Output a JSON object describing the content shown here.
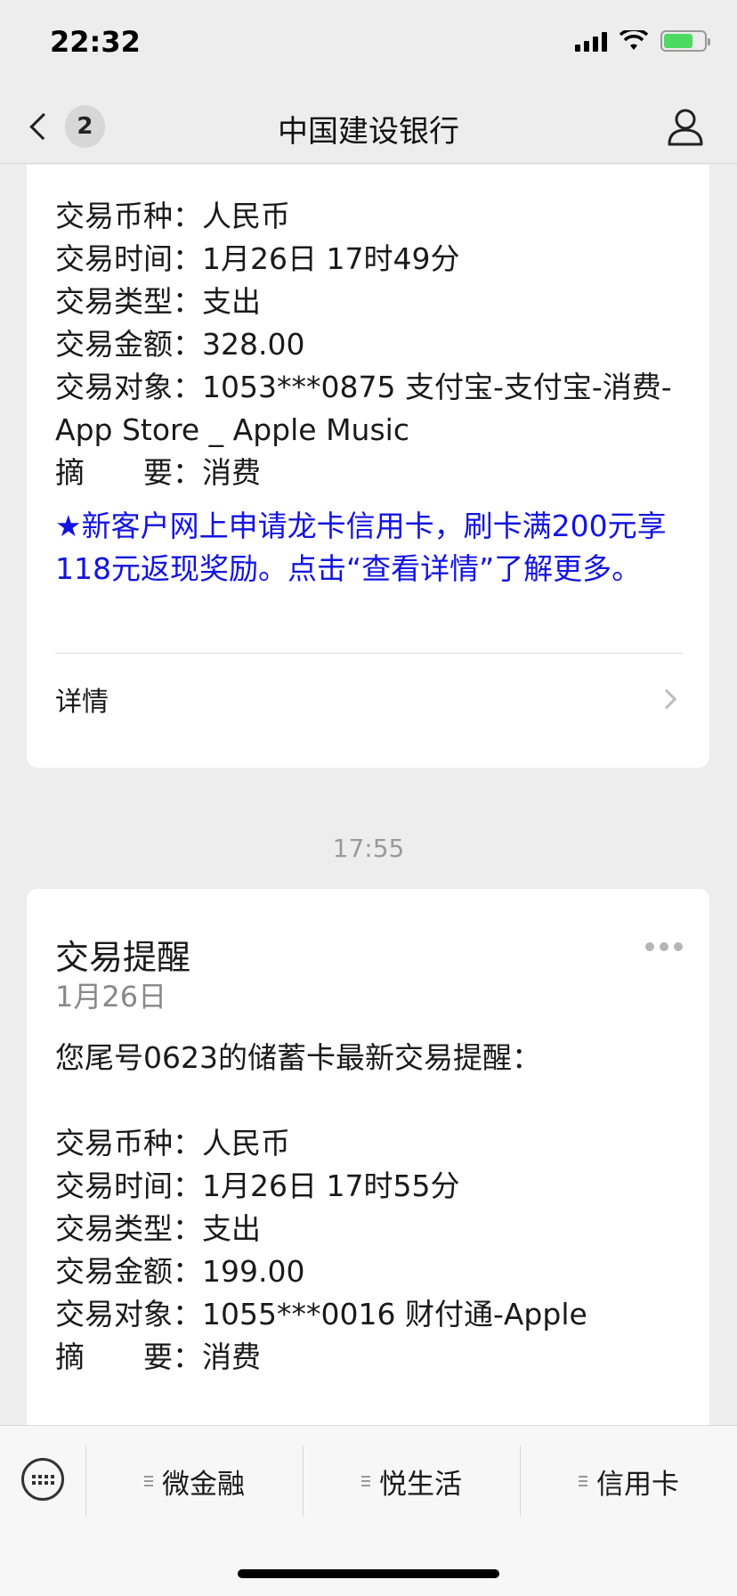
{
  "status": {
    "time": "22:32"
  },
  "nav": {
    "unread_count": "2",
    "title": "中国建设银行"
  },
  "card1": {
    "fields": [
      {
        "label": "交易币种：",
        "value": "人民币"
      },
      {
        "label": "交易时间：",
        "value": "1月26日 17时49分"
      },
      {
        "label": "交易类型：",
        "value": "支出"
      },
      {
        "label": "交易金额：",
        "value": "328.00"
      },
      {
        "label": "交易对象：",
        "value": "1053***0875 支付宝-支付宝-消费-App Store _ Apple Music"
      },
      {
        "label": "摘　　要：",
        "value": "消费"
      }
    ],
    "promo": "★新客户网上申请龙卡信用卡，刷卡满200元享118元返现奖励。点击“查看详情”了解更多。",
    "details_label": "详情"
  },
  "timestamp": "17:55",
  "card2": {
    "title": "交易提醒",
    "date": "1月26日",
    "intro": "您尾号0623的储蓄卡最新交易提醒：",
    "fields": [
      {
        "label": "交易币种：",
        "value": "人民币"
      },
      {
        "label": "交易时间：",
        "value": "1月26日 17时55分"
      },
      {
        "label": "交易类型：",
        "value": "支出"
      },
      {
        "label": "交易金额：",
        "value": "199.00"
      },
      {
        "label": "交易对象：",
        "value": "1055***0016 财付通-Apple"
      },
      {
        "label": "摘　　要：",
        "value": "消费"
      }
    ]
  },
  "menu": {
    "items": [
      {
        "label": "微金融"
      },
      {
        "label": "悦生活"
      },
      {
        "label": "信用卡"
      }
    ]
  },
  "colors": {
    "promo": "#1414e0",
    "background": "#ededed"
  },
  "icons": [
    "back-chevron-icon",
    "profile-icon",
    "chevron-right-icon",
    "more-icon",
    "keyboard-icon",
    "menu-list-icon"
  ]
}
